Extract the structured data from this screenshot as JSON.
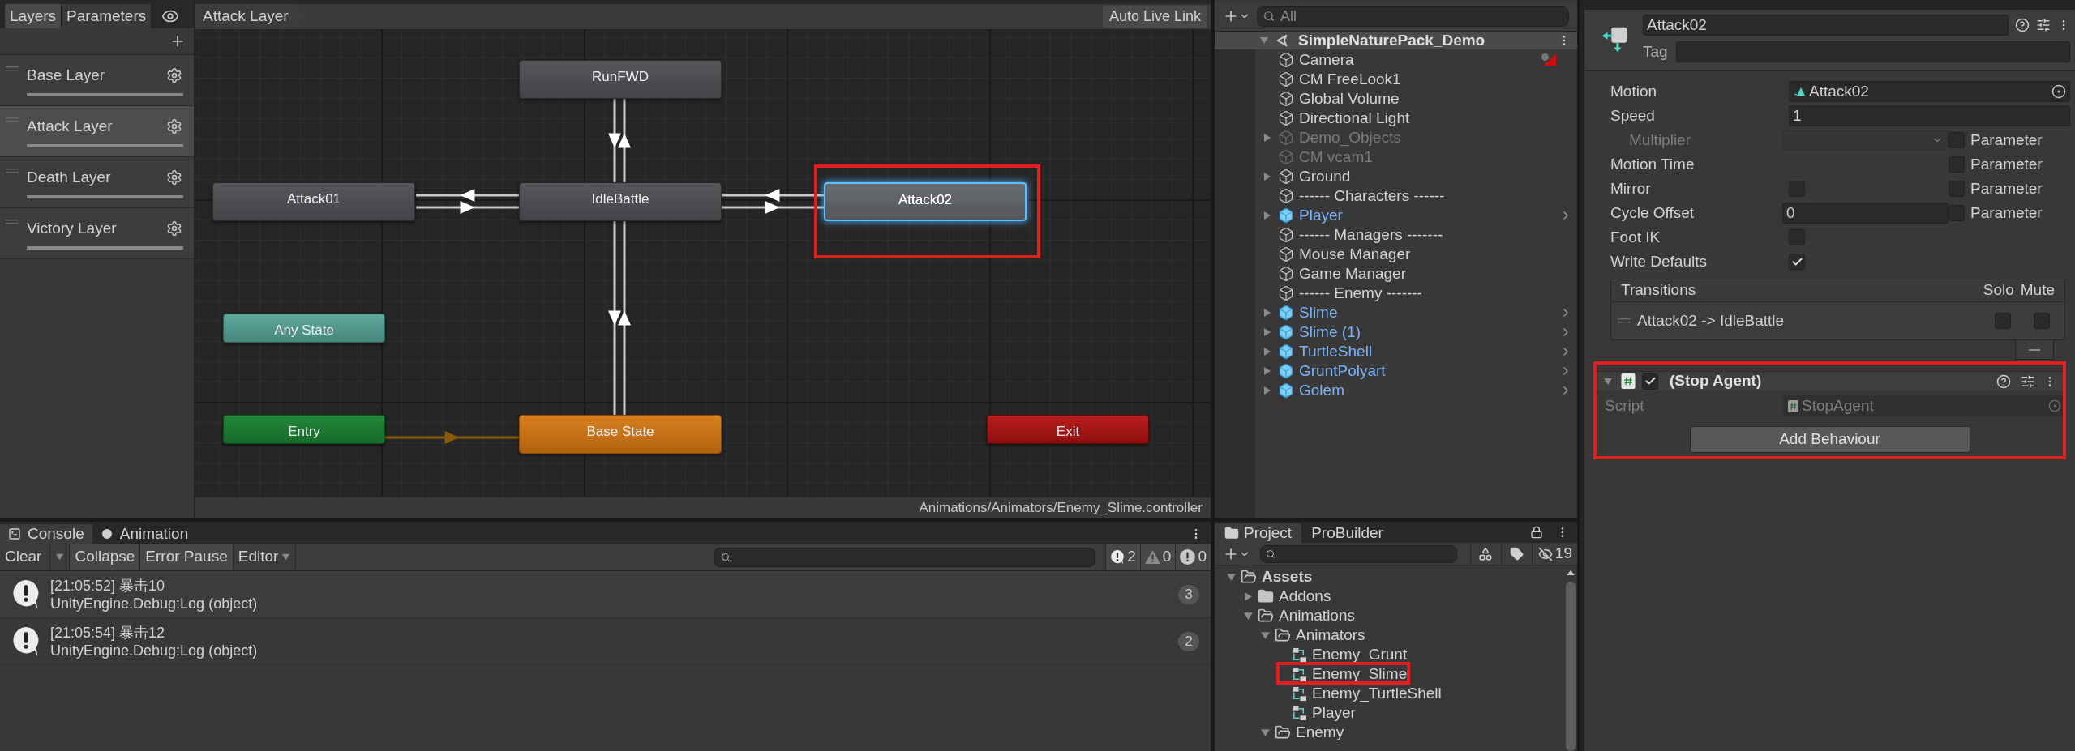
{
  "animator": {
    "tabs": [
      {
        "label": "Layers",
        "selected": true
      },
      {
        "label": "Parameters",
        "selected": false
      }
    ],
    "layers": [
      {
        "name": "Base Layer",
        "selected": false,
        "level": 1
      },
      {
        "name": "Attack Layer",
        "selected": true,
        "level": 1
      },
      {
        "name": "Death Layer",
        "selected": false,
        "level": 1
      },
      {
        "name": "Victory Layer",
        "selected": false,
        "level": 1
      }
    ],
    "breadcrumb": "Attack Layer",
    "live_link": "Auto Live Link",
    "states": [
      {
        "label": "RunFWD",
        "kind": "state",
        "selected": false
      },
      {
        "label": "Attack01",
        "kind": "state",
        "selected": false
      },
      {
        "label": "IdleBattle",
        "kind": "state",
        "selected": false
      },
      {
        "label": "Attack02",
        "kind": "state",
        "selected": true
      },
      {
        "label": "Any State",
        "kind": "any",
        "selected": false
      },
      {
        "label": "Entry",
        "kind": "entry",
        "selected": false
      },
      {
        "label": "Base State",
        "kind": "default",
        "selected": false
      },
      {
        "label": "Exit",
        "kind": "exit",
        "selected": false
      }
    ],
    "path": "Animations/Animators/Enemy_Slime.controller"
  },
  "hierarchy": {
    "search_placeholder": "All",
    "scene": "SimpleNaturePack_Demo",
    "items": [
      {
        "label": "Camera",
        "kind": "object",
        "expandable": false,
        "disabled": false,
        "flagged": true
      },
      {
        "label": "CM FreeLook1",
        "kind": "object",
        "expandable": false,
        "disabled": false,
        "flagged": false
      },
      {
        "label": "Global Volume",
        "kind": "object",
        "expandable": false,
        "disabled": false,
        "flagged": false
      },
      {
        "label": "Directional Light",
        "kind": "object",
        "expandable": false,
        "disabled": false,
        "flagged": false
      },
      {
        "label": "Demo_Objects",
        "kind": "object",
        "expandable": true,
        "disabled": true,
        "flagged": false
      },
      {
        "label": "CM vcam1",
        "kind": "object",
        "expandable": false,
        "disabled": true,
        "flagged": false
      },
      {
        "label": "Ground",
        "kind": "object",
        "expandable": true,
        "disabled": false,
        "flagged": false
      },
      {
        "label": "------ Characters ------",
        "kind": "object",
        "expandable": false,
        "disabled": false,
        "flagged": false
      },
      {
        "label": "Player",
        "kind": "prefab",
        "expandable": true,
        "disabled": false,
        "flagged": false
      },
      {
        "label": "------ Managers -------",
        "kind": "object",
        "expandable": false,
        "disabled": false,
        "flagged": false
      },
      {
        "label": "Mouse Manager",
        "kind": "object",
        "expandable": false,
        "disabled": false,
        "flagged": false
      },
      {
        "label": "Game Manager",
        "kind": "object",
        "expandable": false,
        "disabled": false,
        "flagged": false
      },
      {
        "label": "------ Enemy -------",
        "kind": "object",
        "expandable": false,
        "disabled": false,
        "flagged": false
      },
      {
        "label": "Slime",
        "kind": "prefab",
        "expandable": true,
        "disabled": false,
        "flagged": false
      },
      {
        "label": "Slime (1)",
        "kind": "prefab",
        "expandable": true,
        "disabled": false,
        "flagged": false
      },
      {
        "label": "TurtleShell",
        "kind": "prefab",
        "expandable": true,
        "disabled": false,
        "flagged": false
      },
      {
        "label": "GruntPolyart",
        "kind": "prefab",
        "expandable": true,
        "disabled": false,
        "flagged": false
      },
      {
        "label": "Golem",
        "kind": "prefab",
        "expandable": true,
        "disabled": false,
        "flagged": false
      }
    ]
  },
  "inspector": {
    "name": "Attack02",
    "tag_label": "Tag",
    "properties": [
      {
        "label": "Motion",
        "kind": "object",
        "value": "Attack02",
        "disabled": false
      },
      {
        "label": "Speed",
        "kind": "text",
        "value": "1",
        "disabled": false
      },
      {
        "label": "Multiplier",
        "kind": "dropdown",
        "disabled": true,
        "parameter": "Parameter",
        "parameter_checked": false
      },
      {
        "label": "Motion Time",
        "kind": "none",
        "disabled": false,
        "parameter": "Parameter",
        "parameter_checked": false
      },
      {
        "label": "Mirror",
        "kind": "checkbox",
        "checked": false,
        "disabled": false,
        "parameter": "Parameter",
        "parameter_checked": false
      },
      {
        "label": "Cycle Offset",
        "kind": "text",
        "value": "0",
        "disabled": false,
        "parameter": "Parameter",
        "parameter_checked": false
      },
      {
        "label": "Foot IK",
        "kind": "checkbox",
        "checked": false,
        "disabled": false
      },
      {
        "label": "Write Defaults",
        "kind": "checkbox",
        "checked": true,
        "disabled": false
      }
    ],
    "transitions": {
      "title": "Transitions",
      "solo_label": "Solo",
      "mute_label": "Mute",
      "rows": [
        {
          "label": "Attack02 -> IdleBattle",
          "solo": false,
          "mute": false
        }
      ]
    },
    "behaviour": {
      "title": "(Stop Agent)",
      "enabled": true,
      "expanded": true,
      "script_label": "Script",
      "script": "StopAgent"
    },
    "add_button": "Add Behaviour"
  },
  "console": {
    "tabs": [
      {
        "label": "Console",
        "kind": "console",
        "selected": true
      },
      {
        "label": "Animation",
        "kind": "animation",
        "selected": false
      }
    ],
    "buttons": [
      {
        "label": "Clear",
        "kind": "split"
      },
      {
        "label": "Collapse",
        "kind": "toggle"
      },
      {
        "label": "Error Pause",
        "kind": "toggle"
      },
      {
        "label": "Editor",
        "kind": "dropdown"
      }
    ],
    "counts": [
      {
        "kind": "info",
        "count": "2"
      },
      {
        "kind": "warning",
        "count": "0"
      },
      {
        "kind": "error",
        "count": "0"
      }
    ],
    "entries": [
      {
        "message": "[21:05:52] 暴击10",
        "trace": "UnityEngine.Debug:Log (object)",
        "count": "3"
      },
      {
        "message": "[21:05:54] 暴击12",
        "trace": "UnityEngine.Debug:Log (object)",
        "count": "2"
      }
    ]
  },
  "project": {
    "tabs": [
      {
        "label": "Project",
        "selected": true
      },
      {
        "label": "ProBuilder",
        "selected": false
      }
    ],
    "hidden_count": "19",
    "tree": [
      {
        "label": "Assets",
        "kind": "folder",
        "expanded": true,
        "children": [
          {
            "label": "Addons",
            "kind": "folder",
            "expanded": false
          },
          {
            "label": "Animations",
            "kind": "folder",
            "expanded": true,
            "children": [
              {
                "label": "Animators",
                "kind": "folder",
                "expanded": true,
                "children": [
                  {
                    "label": "Enemy_Grunt",
                    "kind": "controller"
                  },
                  {
                    "label": "Enemy_Slime",
                    "kind": "controller"
                  },
                  {
                    "label": "Enemy_TurtleShell",
                    "kind": "controller"
                  },
                  {
                    "label": "Player",
                    "kind": "controller"
                  }
                ]
              },
              {
                "label": "Enemy",
                "kind": "folder",
                "expanded": true
              }
            ]
          }
        ]
      }
    ]
  }
}
